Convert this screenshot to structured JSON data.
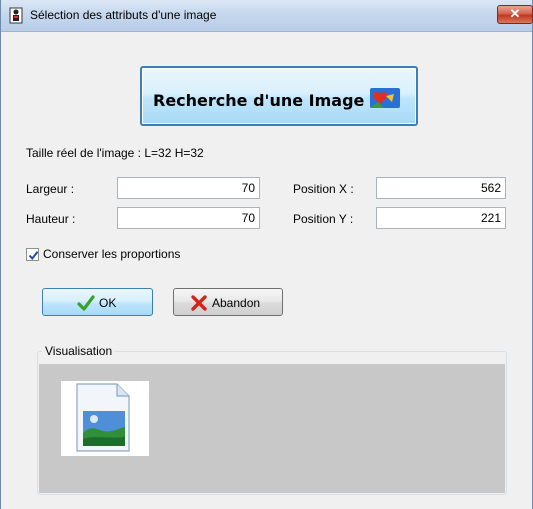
{
  "window": {
    "title": "Sélection des attributs d'une image",
    "close_label": "✕"
  },
  "search_button": {
    "label": "Recherche d'une Image",
    "icon": "image-search-icon"
  },
  "info": {
    "text": "Taille réel de l'image : L=32 H=32"
  },
  "fields": {
    "width": {
      "label": "Largeur :",
      "value": "70"
    },
    "height": {
      "label": "Hauteur :",
      "value": "70"
    },
    "pos_x": {
      "label": "Position X :",
      "value": "562"
    },
    "pos_y": {
      "label": "Position Y :",
      "value": "221"
    }
  },
  "keep_ratio": {
    "label": "Conserver les proportions",
    "checked": true
  },
  "buttons": {
    "ok": {
      "label": "OK",
      "icon": "checkmark-icon"
    },
    "cancel": {
      "label": "Abandon",
      "icon": "cross-icon"
    }
  },
  "preview": {
    "title": "Visualisation",
    "icon": "image-file-icon"
  },
  "colors": {
    "accent_border": "#3c7fb1",
    "preview_bg": "#c8c8c8",
    "ok_check": "#3aa02a",
    "cancel_cross": "#d0261c"
  }
}
